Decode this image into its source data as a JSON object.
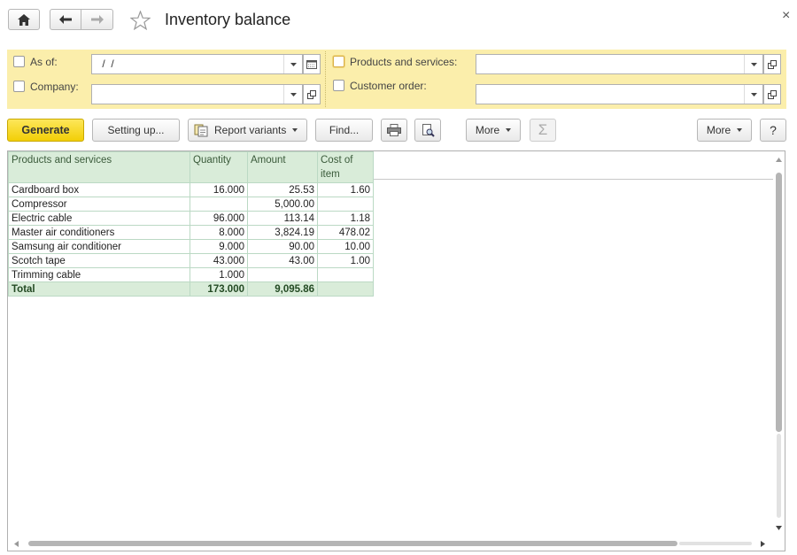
{
  "window": {
    "title": "Inventory balance",
    "close_glyph": "×"
  },
  "nav": {
    "home_icon": "home-icon",
    "back_icon": "arrow-left-icon",
    "forward_icon": "arrow-right-icon",
    "favorite_icon": "star-icon"
  },
  "filters": {
    "as_of": {
      "label": "As of:",
      "value": " /  /"
    },
    "company": {
      "label": "Company:",
      "value": ""
    },
    "products": {
      "label": "Products and services:",
      "value": ""
    },
    "customer_order": {
      "label": "Customer order:",
      "value": ""
    }
  },
  "toolbar": {
    "generate": "Generate",
    "setting_up": "Setting up...",
    "report_variants": "Report variants",
    "find": "Find...",
    "more1": "More",
    "more2": "More",
    "help": "?",
    "sum_glyph": "Σ"
  },
  "report": {
    "columns": [
      "Products and services",
      "Quantity",
      "Amount",
      "Cost of item"
    ],
    "rows": [
      [
        "Cardboard box",
        "16.000",
        "25.53",
        "1.60"
      ],
      [
        "Compressor",
        "",
        "5,000.00",
        ""
      ],
      [
        "Electric cable",
        "96.000",
        "113.14",
        "1.18"
      ],
      [
        "Master air conditioners",
        "8.000",
        "3,824.19",
        "478.02"
      ],
      [
        "Samsung air conditioner",
        "9.000",
        "90.00",
        "10.00"
      ],
      [
        "Scotch tape",
        "43.000",
        "43.00",
        "1.00"
      ],
      [
        "Trimming cable",
        "1.000",
        "",
        ""
      ]
    ],
    "total": [
      "Total",
      "173.000",
      "9,095.86",
      ""
    ]
  },
  "colors": {
    "filter_bg": "#fbeeab",
    "generate_bg": "#f4d410",
    "header_bg": "#d9ecd9",
    "grid": "#bbd9c4"
  }
}
